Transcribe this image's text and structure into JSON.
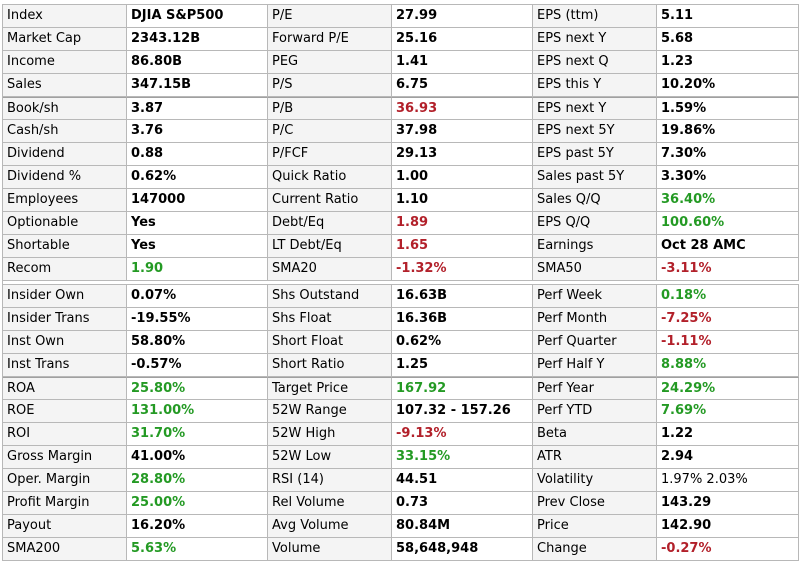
{
  "colors": {
    "positive": "#249a24",
    "negative": "#b2202a",
    "neutral": "#000000"
  },
  "blocks": [
    {
      "rows": [
        [
          {
            "label": "Index",
            "value": "DJIA S&P500"
          },
          {
            "label": "P/E",
            "value": "27.99"
          },
          {
            "label": "EPS (ttm)",
            "value": "5.11"
          }
        ],
        [
          {
            "label": "Market Cap",
            "value": "2343.12B"
          },
          {
            "label": "Forward P/E",
            "value": "25.16"
          },
          {
            "label": "EPS next Y",
            "value": "5.68"
          }
        ],
        [
          {
            "label": "Income",
            "value": "86.80B"
          },
          {
            "label": "PEG",
            "value": "1.41"
          },
          {
            "label": "EPS next Q",
            "value": "1.23"
          }
        ],
        [
          {
            "label": "Sales",
            "value": "347.15B"
          },
          {
            "label": "P/S",
            "value": "6.75"
          },
          {
            "label": "EPS this Y",
            "value": "10.20%"
          }
        ],
        [
          {
            "label": "Book/sh",
            "value": "3.87"
          },
          {
            "label": "P/B",
            "value": "36.93",
            "tone": "negative"
          },
          {
            "label": "EPS next Y",
            "value": "1.59%"
          }
        ],
        [
          {
            "label": "Cash/sh",
            "value": "3.76"
          },
          {
            "label": "P/C",
            "value": "37.98"
          },
          {
            "label": "EPS next 5Y",
            "value": "19.86%"
          }
        ],
        [
          {
            "label": "Dividend",
            "value": "0.88"
          },
          {
            "label": "P/FCF",
            "value": "29.13"
          },
          {
            "label": "EPS past 5Y",
            "value": "7.30%"
          }
        ],
        [
          {
            "label": "Dividend %",
            "value": "0.62%"
          },
          {
            "label": "Quick Ratio",
            "value": "1.00"
          },
          {
            "label": "Sales past 5Y",
            "value": "3.30%"
          }
        ],
        [
          {
            "label": "Employees",
            "value": "147000"
          },
          {
            "label": "Current Ratio",
            "value": "1.10"
          },
          {
            "label": "Sales Q/Q",
            "value": "36.40%",
            "tone": "positive"
          }
        ],
        [
          {
            "label": "Optionable",
            "value": "Yes"
          },
          {
            "label": "Debt/Eq",
            "value": "1.89",
            "tone": "negative"
          },
          {
            "label": "EPS Q/Q",
            "value": "100.60%",
            "tone": "positive"
          }
        ],
        [
          {
            "label": "Shortable",
            "value": "Yes"
          },
          {
            "label": "LT Debt/Eq",
            "value": "1.65",
            "tone": "negative"
          },
          {
            "label": "Earnings",
            "value": "Oct 28 AMC"
          }
        ],
        [
          {
            "label": "Recom",
            "value": "1.90",
            "tone": "positive"
          },
          {
            "label": "SMA20",
            "value": "-1.32%",
            "tone": "negative"
          },
          {
            "label": "SMA50",
            "value": "-3.11%",
            "tone": "negative"
          }
        ]
      ]
    },
    {
      "rows": [
        [
          {
            "label": "Insider Own",
            "value": "0.07%"
          },
          {
            "label": "Shs Outstand",
            "value": "16.63B"
          },
          {
            "label": "Perf Week",
            "value": "0.18%",
            "tone": "positive"
          }
        ],
        [
          {
            "label": "Insider Trans",
            "value": "-19.55%"
          },
          {
            "label": "Shs Float",
            "value": "16.36B"
          },
          {
            "label": "Perf Month",
            "value": "-7.25%",
            "tone": "negative"
          }
        ],
        [
          {
            "label": "Inst Own",
            "value": "58.80%"
          },
          {
            "label": "Short Float",
            "value": "0.62%"
          },
          {
            "label": "Perf Quarter",
            "value": "-1.11%",
            "tone": "negative"
          }
        ],
        [
          {
            "label": "Inst Trans",
            "value": "-0.57%"
          },
          {
            "label": "Short Ratio",
            "value": "1.25"
          },
          {
            "label": "Perf Half Y",
            "value": "8.88%",
            "tone": "positive"
          }
        ],
        [
          {
            "label": "ROA",
            "value": "25.80%",
            "tone": "positive"
          },
          {
            "label": "Target Price",
            "value": "167.92",
            "tone": "positive"
          },
          {
            "label": "Perf Year",
            "value": "24.29%",
            "tone": "positive"
          }
        ],
        [
          {
            "label": "ROE",
            "value": "131.00%",
            "tone": "positive"
          },
          {
            "label": "52W Range",
            "value": "107.32 - 157.26"
          },
          {
            "label": "Perf YTD",
            "value": "7.69%",
            "tone": "positive"
          }
        ],
        [
          {
            "label": "ROI",
            "value": "31.70%",
            "tone": "positive"
          },
          {
            "label": "52W High",
            "value": "-9.13%",
            "tone": "negative"
          },
          {
            "label": "Beta",
            "value": "1.22"
          }
        ],
        [
          {
            "label": "Gross Margin",
            "value": "41.00%"
          },
          {
            "label": "52W Low",
            "value": "33.15%",
            "tone": "positive"
          },
          {
            "label": "ATR",
            "value": "2.94"
          }
        ],
        [
          {
            "label": "Oper. Margin",
            "value": "28.80%",
            "tone": "positive"
          },
          {
            "label": "RSI (14)",
            "value": "44.51"
          },
          {
            "label": "Volatility",
            "value": "1.97% 2.03%",
            "tone": "neutral-light"
          }
        ],
        [
          {
            "label": "Profit Margin",
            "value": "25.00%",
            "tone": "positive"
          },
          {
            "label": "Rel Volume",
            "value": "0.73"
          },
          {
            "label": "Prev Close",
            "value": "143.29"
          }
        ],
        [
          {
            "label": "Payout",
            "value": "16.20%"
          },
          {
            "label": "Avg Volume",
            "value": "80.84M"
          },
          {
            "label": "Price",
            "value": "142.90"
          }
        ],
        [
          {
            "label": "SMA200",
            "value": "5.63%",
            "tone": "positive"
          },
          {
            "label": "Volume",
            "value": "58,648,948"
          },
          {
            "label": "Change",
            "value": "-0.27%",
            "tone": "negative"
          }
        ]
      ]
    }
  ]
}
